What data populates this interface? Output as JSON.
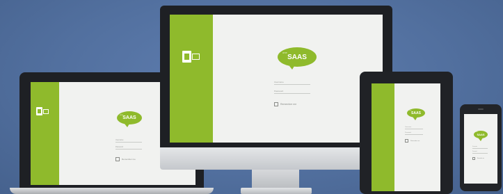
{
  "brand": {
    "bubble_small": "one",
    "bubble_text": "SAAS",
    "accent": "#8fba2c"
  },
  "login": {
    "username_label": "Username",
    "password_label": "Password",
    "remember_label": "Remember me"
  },
  "background": "#52709f"
}
